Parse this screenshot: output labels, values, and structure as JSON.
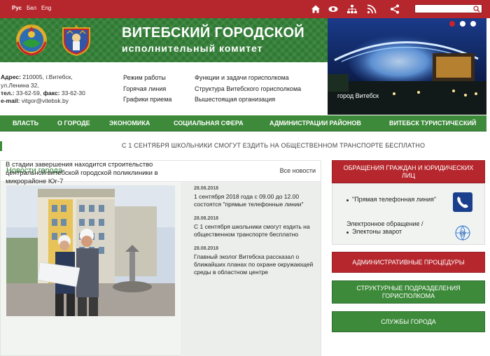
{
  "header": {
    "languages": [
      "Рус",
      "Бел",
      "Eng"
    ],
    "search_placeholder": "",
    "icons": [
      "home-icon",
      "eye-icon",
      "sitemap-icon",
      "rss-icon",
      "share-icon",
      "search-icon"
    ]
  },
  "banner": {
    "title": "ВИТЕБСКИЙ ГОРОДСКОЙ",
    "subtitle": "исполнительный комитет",
    "photo_caption": "город Витебск"
  },
  "info": {
    "address_label": "Адрес:",
    "address_line1": " 210005, г.Витебск,",
    "address_line2": "ул.Ленина 32,",
    "phone_label": "тел.:",
    "phone_value": " 33-62-59, ",
    "fax_label": "факс:",
    "fax_value": " 33-62-30",
    "email_label": "e-mail:",
    "email_value": " vitgor@vitebsk.by",
    "links_col1": [
      "Режим работы",
      "Горячая линия",
      "Графики приема"
    ],
    "links_col2": [
      "Функции и задачи горисполкома",
      "Структура Витебского горисполкома",
      "Вышестоящая организация"
    ]
  },
  "nav": [
    "ВЛАСТЬ",
    "О ГОРОДЕ",
    "ЭКОНОМИКА",
    "СОЦИАЛЬНАЯ СФЕРА",
    "АДМИНИСТРАЦИИ РАЙОНОВ",
    "ВИТЕБСК ТУРИСТИЧЕСКИЙ"
  ],
  "ticker": "С 1 СЕНТЯБРЯ ШКОЛЬНИКИ СМОГУТ ЕЗДИТЬ НА ОБЩЕСТВЕННОМ ТРАНСПОРТЕ БЕСПЛАТНО",
  "news": {
    "title": "Новости города",
    "all_link": "Все новости",
    "main_headline": "В стадии завершения находится строительство центральной витебской городской поликлиники в микрорайоне Юг-7",
    "items": [
      {
        "date": "28.08.2018",
        "text": "1  сентября 2018 года с 09.00 до 12.00 состоятся \"прямые телефонные линии\""
      },
      {
        "date": "28.08.2018",
        "text": "С 1 сентября школьники смогут ездить на общественном транспорте бесплатно"
      },
      {
        "date": "28.08.2018",
        "text": "Главный эколог Витебска рассказал о ближайших планах по охране окружающей среды в областном центре"
      }
    ]
  },
  "sidebar": {
    "appeals_button": "ОБРАЩЕНИЯ ГРАЖДАН И ЮРИДИЧЕСКИХ ЛИЦ",
    "hotline": "\"Прямая телефонная линия\"",
    "electronic_line1": "Электронное обращение /",
    "electronic_line2": "Электоны зварот",
    "admin_procedures": "АДМИНИСТРАТИВНЫЕ ПРОЦЕДУРЫ",
    "structural": "СТРУКТУРНЫЕ ПОДРАЗДЕЛЕНИЯ ГОРИСПОЛКОМА",
    "services": "СЛУЖБЫ ГОРОДА"
  },
  "colors": {
    "brand_red": "#b6272d",
    "brand_green": "#3d8a3a",
    "heading_green": "#2e7d32"
  }
}
